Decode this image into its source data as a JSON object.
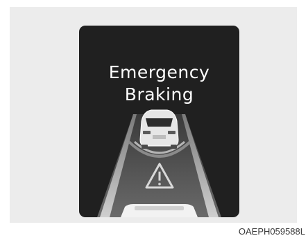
{
  "display": {
    "title_line1": "Emergency",
    "title_line2": "Braking",
    "warning_icon": "warning-triangle-icon",
    "vehicle_icon": "front-vehicle-icon",
    "own_vehicle_icon": "own-vehicle-hood-icon"
  },
  "caption": "OAEPH059588L"
}
